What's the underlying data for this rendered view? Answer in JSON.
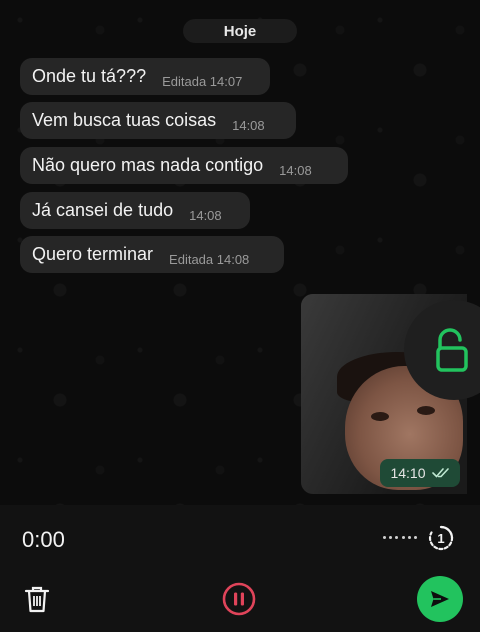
{
  "chat": {
    "date_label": "Hoje",
    "messages": [
      {
        "text": "Onde tu tá???",
        "meta": "Editada 14:07"
      },
      {
        "text": "Vem busca tuas coisas",
        "meta": "14:08"
      },
      {
        "text": "Não quero mas nada contigo",
        "meta": "14:08"
      },
      {
        "text": "Já cansei de tudo",
        "meta": "14:08"
      },
      {
        "text": "Quero terminar",
        "meta": "Editada 14:08"
      }
    ],
    "outgoing_media": {
      "time": "14:10",
      "status_icon": "double-check-icon"
    }
  },
  "recorder": {
    "elapsed": "0:00",
    "speed_icon": "view-once-icon",
    "lock_icon": "unlock-icon",
    "delete_icon": "trash-icon",
    "pause_icon": "pause-icon",
    "send_icon": "send-icon"
  },
  "colors": {
    "accent_green": "#22c35e",
    "pause_red": "#e0445a",
    "media_time_bg": "#1f4a36"
  }
}
